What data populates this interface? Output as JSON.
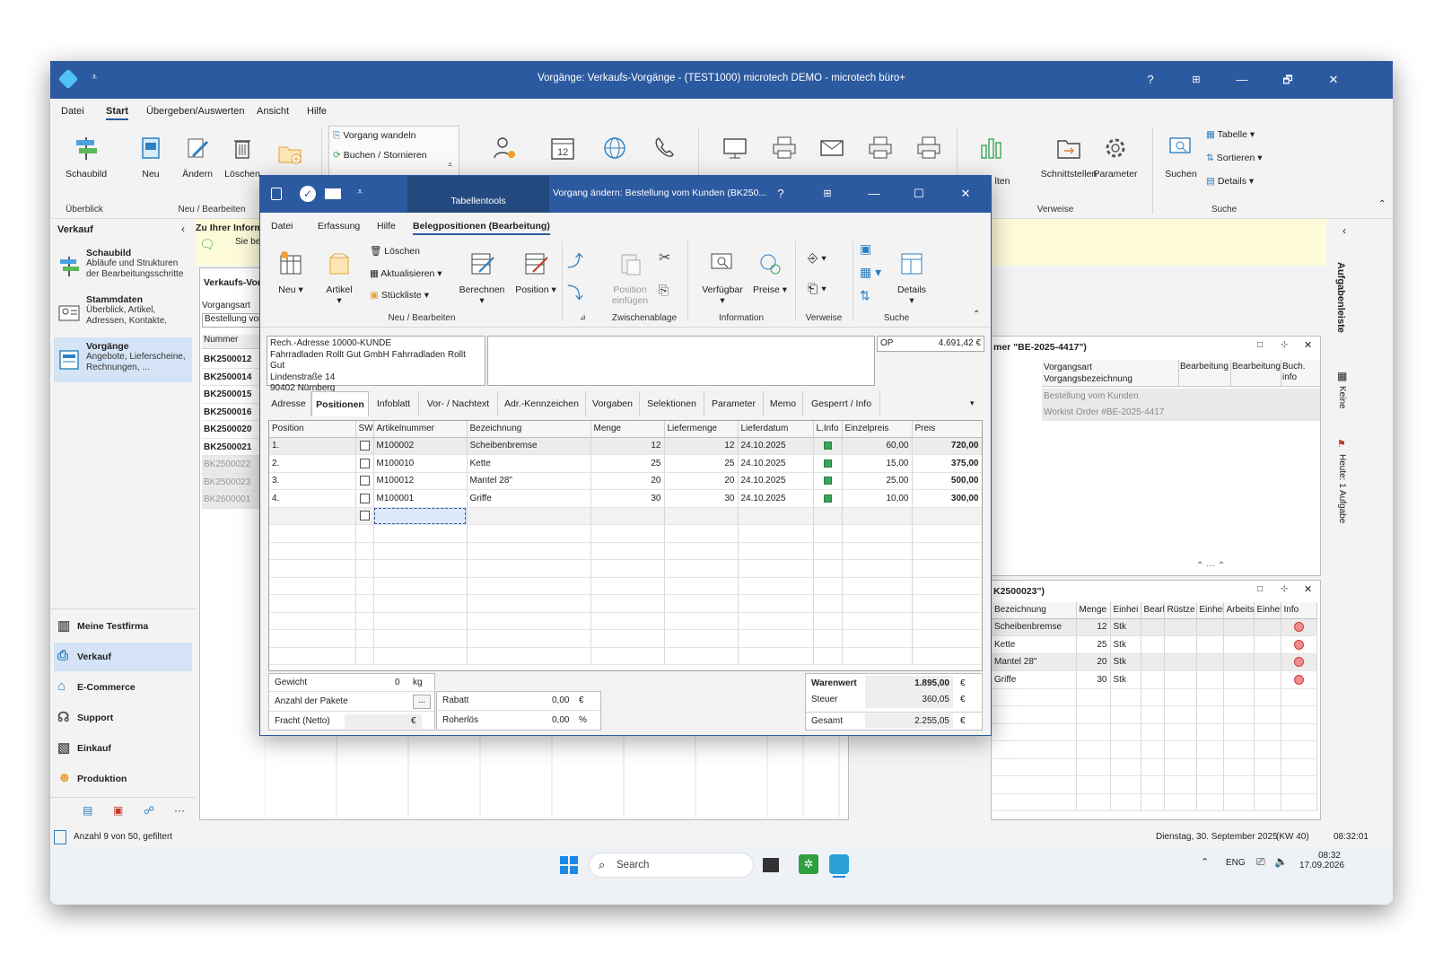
{
  "window": {
    "title": "Vorgänge: Verkaufs-Vorgänge - (TEST1000) microtech DEMO - microtech büro+",
    "help": "?",
    "minimize": "—",
    "restore": "🗗",
    "close": "✕"
  },
  "menu": [
    "Datei",
    "Start",
    "Übergeben/Auswerten",
    "Ansicht",
    "Hilfe"
  ],
  "ribbon": {
    "schaubild": "Schaubild",
    "neu": "Neu",
    "aendern": "Ändern",
    "loeschen": "Löschen",
    "vorgang_wandeln": "Vorgang wandeln",
    "buchen_stornieren": "Buchen / Stornieren",
    "schnittstellen": "Schnittstellen",
    "parameter": "Parameter",
    "suchen": "Suchen",
    "tabelle": "Tabelle",
    "sortieren": "Sortieren",
    "details": "Details",
    "halten_partial": "lten",
    "groups": {
      "ueberblick": "Überblick",
      "neu_bearbeiten": "Neu / Bearbeiten",
      "verweise": "Verweise",
      "suche": "Suche"
    }
  },
  "sidebar": {
    "header": "Verkauf",
    "items": [
      {
        "title": "Schaubild",
        "desc": "Abläufe und Strukturen der Bearbeitungsschritte"
      },
      {
        "title": "Stammdaten",
        "desc": "Überblick, Artikel, Adressen, Kontakte,"
      },
      {
        "title": "Vorgänge",
        "desc": "Angebote, Lieferscheine, Rechnungen, ..."
      }
    ],
    "bottom": [
      "Meine Testfirma",
      "Verkauf",
      "E-Commerce",
      "Support",
      "Einkauf",
      "Produktion"
    ],
    "more": "···"
  },
  "info_bar": {
    "title": "Zu Ihrer Inform",
    "text": "Sie bet"
  },
  "main_list": {
    "title": "Verkaufs-Vor",
    "filter_label": "Vorgangsart",
    "filter_value": "Bestellung vor",
    "col": "Nummer",
    "rows": [
      {
        "nr": "BK2500012",
        "bold": true
      },
      {
        "nr": "BK2500014",
        "bold": true
      },
      {
        "nr": "BK2500015",
        "bold": true
      },
      {
        "nr": "BK2500016",
        "bold": true
      },
      {
        "nr": "BK2500020",
        "bold": true
      },
      {
        "nr": "BK2500021",
        "bold": true
      },
      {
        "nr": "BK2500022",
        "bold": false
      },
      {
        "nr": "BK2500023",
        "bold": false
      },
      {
        "nr": "BK2600001",
        "bold": false
      }
    ]
  },
  "right_panel_top": {
    "title": "mer \"BE-2025-4417\")",
    "cols": [
      "Vorgangsart\nVorgangsbezeichnung",
      "Bearbeitung",
      "Bearbeitung",
      "Buch. info"
    ],
    "row": {
      "a": "Bestellung vom Kunden",
      "b": "Workist Order #BE-2025-4417"
    }
  },
  "right_panel_bottom": {
    "title": "K2500023\")",
    "cols": [
      "Bezeichnung",
      "Menge",
      "Einhei",
      "Bearl",
      "Rüstze",
      "Einhei",
      "Arbeits",
      "Einhei",
      "Info"
    ],
    "rows": [
      {
        "bez": "Scheibenbremse",
        "menge": "12",
        "einh": "Stk"
      },
      {
        "bez": "Kette",
        "menge": "25",
        "einh": "Stk"
      },
      {
        "bez": "Mantel 28\"",
        "menge": "20",
        "einh": "Stk"
      },
      {
        "bez": "Griffe",
        "menge": "30",
        "einh": "Stk"
      }
    ]
  },
  "aufgaben": {
    "title": "Aufgabenleiste",
    "keine": "Keine",
    "heute": "Heute: 1 Aufgabe"
  },
  "status": {
    "left": "Anzahl 9 von 50, gefiltert",
    "date": "Dienstag, 30. September 2025",
    "kw": "(KW 40)",
    "time": "08:32:01"
  },
  "taskbar": {
    "search": "Search",
    "lang": "ENG",
    "time": "08:32",
    "date": "17.09.2026"
  },
  "dialog": {
    "tab_tools": "Tabellentools",
    "title": "Vorgang ändern: Bestellung vom Kunden (BK250...",
    "help": "?",
    "menu": [
      "Datei",
      "Erfassung",
      "Hilfe",
      "Belegpositionen (Bearbeitung)"
    ],
    "ribbon": {
      "neu": "Neu",
      "artikel": "Artikel",
      "loeschen": "Löschen",
      "aktualisieren": "Aktualisieren",
      "stueckliste": "Stückliste",
      "berechnen": "Berechnen",
      "position": "Position",
      "position_einfuegen": "Position einfügen",
      "verfuegbar": "Verfügbar",
      "preise": "Preise",
      "details": "Details",
      "groups": {
        "neu_bearbeiten": "Neu / Bearbeiten",
        "zwischenablage": "Zwischenablage",
        "information": "Information",
        "verweise": "Verweise",
        "suche": "Suche"
      }
    },
    "address": [
      "Rech.-Adresse 10000-KUNDE",
      "Fahrradladen Rollt Gut GmbH Fahrradladen Rollt Gut",
      "Lindenstraße 14",
      "90402 Nürnberg"
    ],
    "op_label": "OP",
    "op_value": "4.691,42 €",
    "tabs": [
      "Adresse",
      "Positionen",
      "Infoblatt",
      "Vor- / Nachtext",
      "Adr.-Kennzeichen",
      "Vorgaben",
      "Selektionen",
      "Parameter",
      "Memo",
      "Gesperrt / Info"
    ],
    "grid_cols": [
      "Position",
      "SW",
      "Artikelnummer",
      "Bezeichnung",
      "Menge",
      "Liefermenge",
      "Lieferdatum",
      "L.Info",
      "Einzelpreis",
      "Preis"
    ],
    "rows": [
      {
        "pos": "1.",
        "art": "M100002",
        "bez": "Scheibenbremse",
        "menge": "12",
        "lief": "12",
        "datum": "24.10.2025",
        "ep": "60,00",
        "preis": "720,00"
      },
      {
        "pos": "2.",
        "art": "M100010",
        "bez": "Kette",
        "menge": "25",
        "lief": "25",
        "datum": "24.10.2025",
        "ep": "15,00",
        "preis": "375,00"
      },
      {
        "pos": "3.",
        "art": "M100012",
        "bez": "Mantel 28\"",
        "menge": "20",
        "lief": "20",
        "datum": "24.10.2025",
        "ep": "25,00",
        "preis": "500,00"
      },
      {
        "pos": "4.",
        "art": "M100001",
        "bez": "Griffe",
        "menge": "30",
        "lief": "30",
        "datum": "24.10.2025",
        "ep": "10,00",
        "preis": "300,00"
      }
    ],
    "footer": {
      "gewicht_label": "Gewicht",
      "gewicht_value": "0",
      "gewicht_unit": "kg",
      "pakete_label": "Anzahl der Pakete",
      "pakete_btn": "...",
      "fracht_label": "Fracht (Netto)",
      "fracht_unit": "€",
      "rabatt_label": "Rabatt",
      "rabatt_value": "0,00",
      "rabatt_unit": "€",
      "roherloes_label": "Roherlös",
      "roherloes_value": "0,00",
      "roherloes_unit": "%",
      "warenwert_label": "Warenwert",
      "warenwert_value": "1.895,00",
      "steuer_label": "Steuer",
      "steuer_value": "360,05",
      "gesamt_label": "Gesamt",
      "gesamt_value": "2.255,05",
      "currency": "€"
    }
  },
  "colors": {
    "accent": "#2c5aa0",
    "selected": "#d4e3f5",
    "info_bar": "#fefbd9"
  }
}
